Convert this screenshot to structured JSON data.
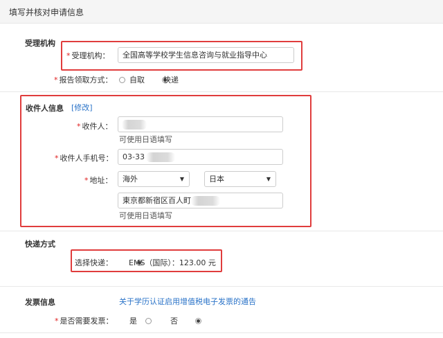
{
  "header": {
    "title": "填写并核对申请信息"
  },
  "agency": {
    "section_title": "受理机构",
    "required_mark": "*",
    "agency_label": "受理机构：",
    "agency_value": "全国高等学校学生信息咨询与就业指导中心",
    "pickup_label": "报告领取方式：",
    "pickup_options": [
      "自取",
      "快递"
    ],
    "pickup_selected": "快递"
  },
  "recipient": {
    "section_title": "收件人信息",
    "edit_link": "[修改]",
    "required_mark": "*",
    "name_label": "收件人：",
    "name_value": "",
    "name_hint": "可使用日语填写",
    "phone_label": "收件人手机号：",
    "phone_value": "03-33",
    "address_label": "地址：",
    "region_value": "海外",
    "country_value": "日本",
    "address_value": "東京都新宿区百人町",
    "address_hint": "可使用日语填写"
  },
  "delivery": {
    "section_title": "快递方式",
    "method_label": "选择快递：",
    "method_option": "EMS（国际）：123.00 元"
  },
  "invoice": {
    "section_title": "发票信息",
    "notice_link": "关于学历认证启用增值税电子发票的通告",
    "required_mark": "*",
    "need_label": "是否需要发票：",
    "options": [
      "是",
      "否"
    ],
    "selected": "否"
  },
  "colors": {
    "highlight_box": "#e03c3c",
    "link": "#2a73c8",
    "required": "#e02020"
  }
}
